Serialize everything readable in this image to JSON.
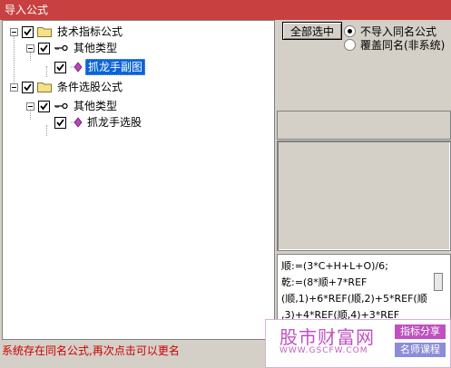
{
  "window": {
    "title": "导入公式"
  },
  "tree": {
    "groups": [
      {
        "label": "技术指标公式",
        "checked": true,
        "child": {
          "label": "其他类型",
          "checked": true,
          "leaf": {
            "label": "抓龙手副图",
            "checked": true,
            "selected": true
          }
        }
      },
      {
        "label": "条件选股公式",
        "checked": true,
        "child": {
          "label": "其他类型",
          "checked": true,
          "leaf": {
            "label": "抓龙手选股",
            "checked": true,
            "selected": false
          }
        }
      }
    ]
  },
  "options": {
    "select_all_label": "全部选中",
    "radio_skip_label": "不导入同名公式",
    "radio_overwrite_label": "覆盖同名(非系统)",
    "selected_radio": "skip"
  },
  "formula": {
    "lines": [
      "顺:=(3*C+H+L+O)/6;",
      "乾:=(8*顺+7*REF",
      "(顺,1)+6*REF(顺,2)+5*REF(顺",
      ",3)+4*REF(顺,4)+3*REF"
    ]
  },
  "status": {
    "message": "系统存在同名公式,再次点击可以更名"
  },
  "watermark": {
    "site_name": "股市财富网",
    "url": "WWW.GSCFW.COM",
    "tag1": "指标分享",
    "tag2": "名师课程"
  },
  "colors": {
    "titlebar": "#c84040",
    "selection": "#0a64d8",
    "status_text": "#cc0000",
    "watermark": "#c050c0"
  }
}
